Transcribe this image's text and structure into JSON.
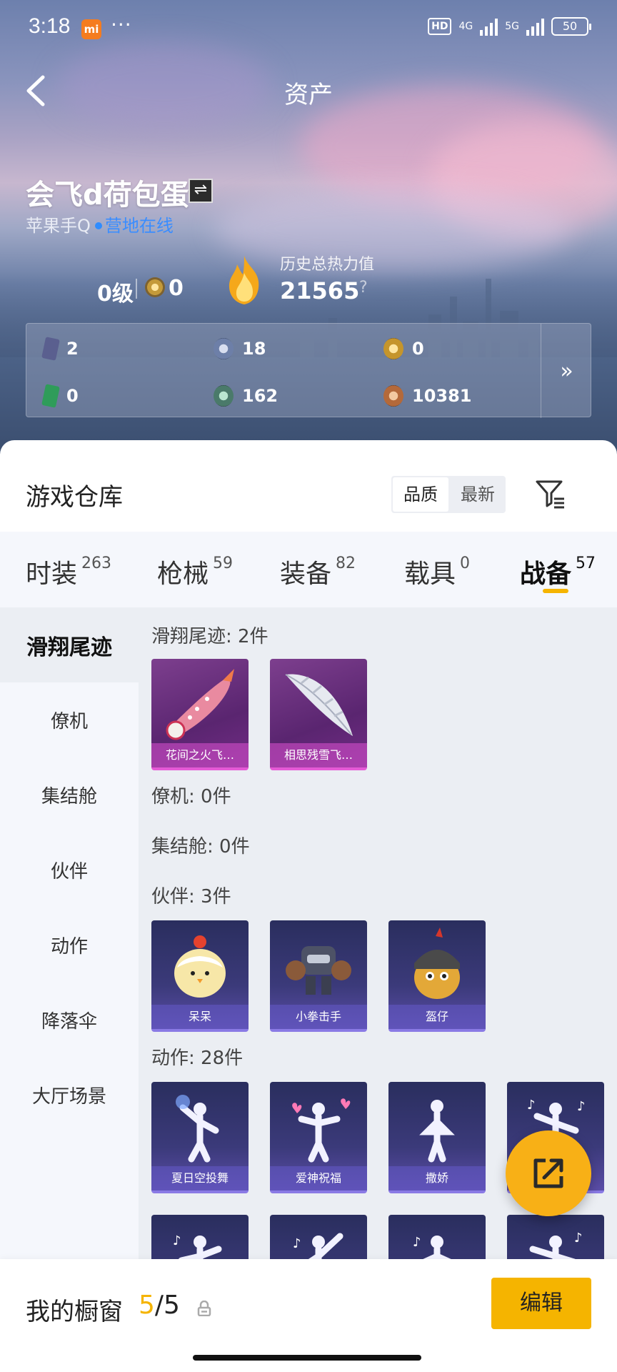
{
  "statusbar": {
    "time": "3:18",
    "carrier_badge": "mi",
    "more": "···",
    "hd": "HD",
    "net1": "4G",
    "net2": "5G",
    "battery": "50"
  },
  "header": {
    "title": "资产"
  },
  "profile": {
    "username": "会飞d荷包蛋",
    "switch_icon": "⇌",
    "account_prefix": "苹果手Q",
    "status": "营地在线",
    "level": "0级",
    "medal_value": "0",
    "heat_label": "历史总热力值",
    "heat_value": "21565",
    "heat_help": "?"
  },
  "resources": [
    {
      "icon": "card-icon",
      "value": "2",
      "color": "#5a5f8f"
    },
    {
      "icon": "coin-blue-icon",
      "value": "18",
      "color": "#6d7fa8"
    },
    {
      "icon": "coin-gold-icon",
      "value": "0",
      "color": "#c5952c"
    },
    {
      "icon": "green-card-icon",
      "value": "0",
      "color": "#2f9c5a"
    },
    {
      "icon": "coin-green-icon",
      "value": "162",
      "color": "#4a7a6a"
    },
    {
      "icon": "coin-bronze-icon",
      "value": "10381",
      "color": "#b4693a"
    }
  ],
  "resources_more": "»",
  "warehouse": {
    "title": "游戏仓库",
    "sort": [
      "品质",
      "最新"
    ],
    "category_tabs": [
      {
        "label": "时装",
        "count": "263"
      },
      {
        "label": "枪械",
        "count": "59"
      },
      {
        "label": "装备",
        "count": "82"
      },
      {
        "label": "载具",
        "count": "0"
      },
      {
        "label": "战备",
        "count": "57"
      }
    ],
    "side_items": [
      "滑翔尾迹",
      "僚机",
      "集结舱",
      "伙伴",
      "动作",
      "降落伞",
      "大厅场景"
    ],
    "sections": {
      "glide": {
        "title": "滑翔尾迹: 2件",
        "items": [
          "花间之火飞…",
          "相思残雪飞…"
        ]
      },
      "wingman": {
        "title": "僚机: 0件"
      },
      "pod": {
        "title": "集结舱: 0件"
      },
      "partner": {
        "title": "伙伴: 3件",
        "items": [
          "呆呆",
          "小拳击手",
          "盔仔"
        ]
      },
      "action": {
        "title": "动作: 28件",
        "items": [
          "夏日空投舞",
          "爱神祝福",
          "撒娇"
        ]
      }
    }
  },
  "bottom": {
    "window_label": "我的橱窗",
    "window_current": "5",
    "window_total": "/5",
    "edit": "编辑"
  },
  "colors": {
    "accent": "#f5b400",
    "online_blue": "#2f8cff",
    "fab": "#f8b016"
  }
}
